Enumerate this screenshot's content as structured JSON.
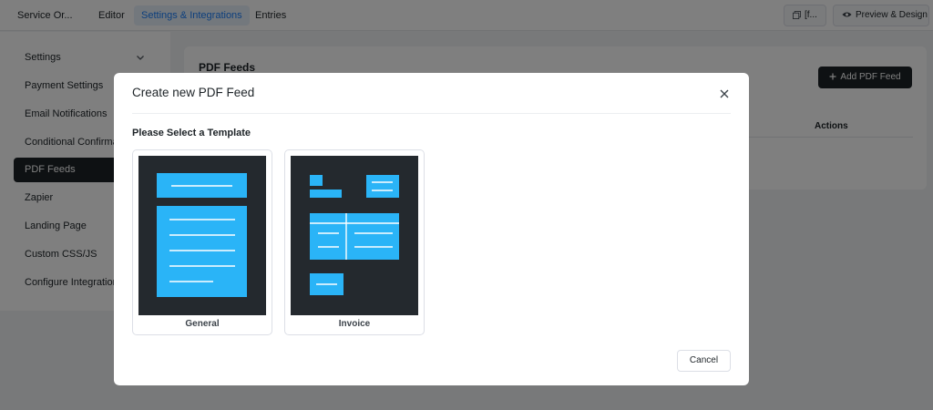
{
  "topbar": {
    "form_title": "Service Or...",
    "tabs": [
      {
        "label": "Editor"
      },
      {
        "label": "Settings & Integrations",
        "active": true
      },
      {
        "label": "Entries"
      }
    ],
    "shortcode_label": "[f...",
    "preview_label": "Preview & Design"
  },
  "sidebar": {
    "items": [
      {
        "label": "Settings"
      },
      {
        "label": "Payment Settings"
      },
      {
        "label": "Email Notifications"
      },
      {
        "label": "Conditional Confirmations"
      },
      {
        "label": "PDF Feeds",
        "active": true
      },
      {
        "label": "Zapier"
      },
      {
        "label": "Landing Page"
      },
      {
        "label": "Custom CSS/JS"
      },
      {
        "label": "Configure Integrations"
      }
    ]
  },
  "content": {
    "title": "PDF Feeds",
    "add_button": "Add PDF Feed",
    "actions_header": "Actions"
  },
  "modal": {
    "title": "Create new PDF Feed",
    "subtitle": "Please Select a Template",
    "templates": [
      {
        "label": "General"
      },
      {
        "label": "Invoice"
      }
    ],
    "cancel_label": "Cancel"
  },
  "colors": {
    "accent": "#1a7efb",
    "thumb_bg": "#24292e",
    "thumb_block": "#2ab4f7",
    "dark_button": "#1d2327"
  }
}
